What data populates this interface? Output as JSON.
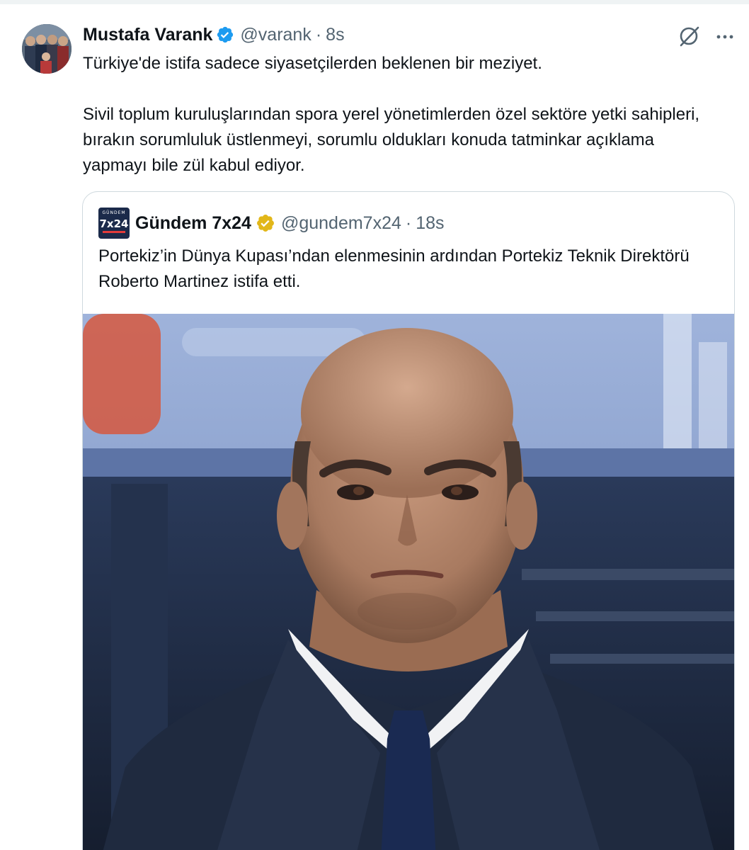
{
  "tweet": {
    "display_name": "Mustafa Varank",
    "handle": "@varank",
    "separator": "·",
    "time": "8s",
    "text_line1": "Türkiye'de istifa sadece siyasetçilerden beklenen bir meziyet.",
    "text_para2": "Sivil toplum kuruluşlarından spora yerel yönetimlerden özel sektöre yetki sahipleri, bırakın sorumluluk üstlenmeyi, sorumlu oldukları konuda tatminkar açıklama yapmayı bile zül kabul ediyor."
  },
  "icons": {
    "verified": "verified-badge-icon",
    "grok": "grok-icon",
    "more": "more-options-icon",
    "affiliate": "gold-verified-badge-icon"
  },
  "quote": {
    "display_name": "Gündem 7x24",
    "handle": "@gundem7x24",
    "separator": "·",
    "time": "18s",
    "logo_small": "GÜNDEM",
    "logo_big": "7x24",
    "text": "Portekiz’in Dünya Kupası’ndan elenmesinin ardından Portekiz Teknik Direktörü Roberto Martinez istifa etti."
  },
  "colors": {
    "text_primary": "#0f1419",
    "text_secondary": "#536471",
    "verified_blue": "#1d9bf0",
    "verified_gold": "#e2b719",
    "border": "#cfd9de"
  }
}
